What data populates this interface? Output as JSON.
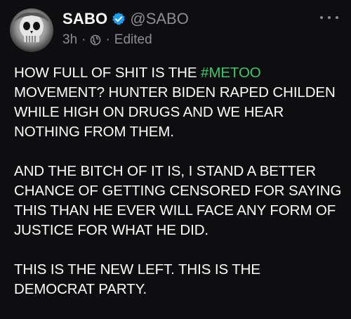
{
  "author": {
    "display_name": "SABO",
    "handle": "@SABO",
    "verified": true,
    "avatar_icon": "skull-avatar"
  },
  "meta": {
    "time": "3h",
    "separator": "·",
    "visibility_icon": "globe-icon",
    "edited_label": "Edited"
  },
  "menu": {
    "icon": "more-dots-icon"
  },
  "post": {
    "p1_before": "HOW FULL OF SHIT IS THE ",
    "hashtag": "#METOO",
    "p1_after": " MOVEMENT? HUNTER BIDEN RAPED CHILDEN WHILE HIGH ON DRUGS AND WE HEAR NOTHING FROM THEM.",
    "p2": "AND THE BITCH OF IT IS, I STAND A BETTER CHANCE OF GETTING CENSORED FOR SAYING THIS THAN HE EVER WILL FACE ANY FORM OF JUSTICE FOR WHAT HE DID.",
    "p3": "THIS IS THE NEW LEFT. THIS IS THE DEMOCRAT PARTY."
  },
  "colors": {
    "background": "#0e0e10",
    "hashtag": "#39c96b",
    "verified": "#1d9bf0",
    "muted": "#8b8d91"
  }
}
